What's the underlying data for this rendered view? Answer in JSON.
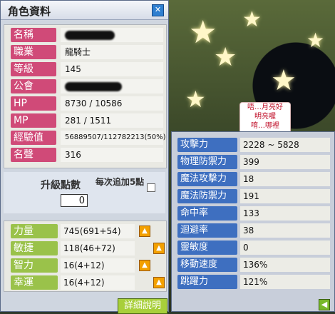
{
  "window": {
    "title": "角色資料",
    "close_icon": "close-icon"
  },
  "profile": [
    {
      "label": "名稱",
      "value": ""
    },
    {
      "label": "職業",
      "value": "龍騎士"
    },
    {
      "label": "等級",
      "value": "145"
    },
    {
      "label": "公會",
      "value": ""
    },
    {
      "label": "HP",
      "value": "8730 / 10586"
    },
    {
      "label": "MP",
      "value": "281 / 1511"
    },
    {
      "label": "經驗值",
      "value": "56889507/112782213(50%)"
    },
    {
      "label": "名聲",
      "value": "316"
    }
  ],
  "ap": {
    "label": "升級點數",
    "value": "0",
    "each_label": "每次追加5點"
  },
  "stats": [
    {
      "label": "力量",
      "value": "745(691+54)"
    },
    {
      "label": "敏捷",
      "value": "118(46+72)"
    },
    {
      "label": "智力",
      "value": "16(4+12)"
    },
    {
      "label": "幸運",
      "value": "16(4+12)"
    }
  ],
  "detail_button": "詳細說明",
  "details": [
    {
      "label": "攻擊力",
      "value": "2228 ~ 5828"
    },
    {
      "label": "物理防禦力",
      "value": "399"
    },
    {
      "label": "魔法攻擊力",
      "value": "18"
    },
    {
      "label": "魔法防禦力",
      "value": "191"
    },
    {
      "label": "命中率",
      "value": "133"
    },
    {
      "label": "迴避率",
      "value": "38"
    },
    {
      "label": "靈敏度",
      "value": "0"
    },
    {
      "label": "移動速度",
      "value": "136%"
    },
    {
      "label": "跳躍力",
      "value": "121%"
    }
  ],
  "npc_sign": [
    "唔…月亮好",
    "明亮喔",
    "唷…哪裡"
  ],
  "back_icon": "back-arrow-icon"
}
